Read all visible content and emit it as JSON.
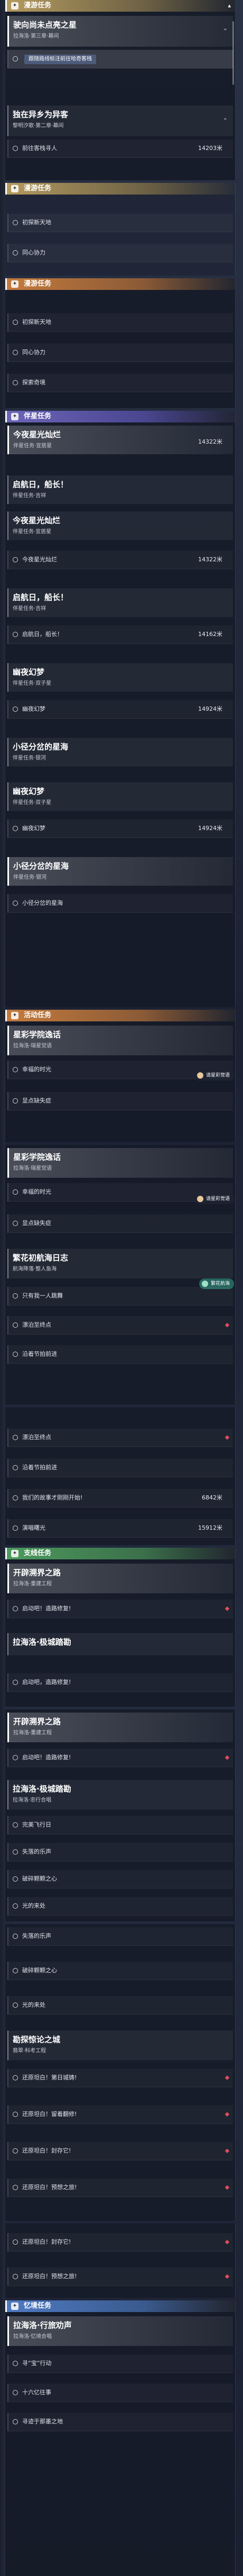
{
  "sections": {
    "trailblaze": "开拓任务",
    "companion": "同行任务",
    "adventure": "冒险任务",
    "daily": "日常任务",
    "event": "活动任务",
    "side": "支线任务",
    "memoir": "忆境任务"
  },
  "frame1": {
    "header": "漫游任务",
    "card1": {
      "title": "驶向尚未点亮之星",
      "sub": "拉海洛·第三章·幕间"
    },
    "step1": "跟随路线标注前往哈奇客栈",
    "card2": {
      "title": "独在异乡为异客",
      "sub": "黎明汐歌·第二章·幕间"
    },
    "step2": "前往客栈寻人",
    "dist2": "14203米"
  },
  "frame2": {
    "header": "漫游任务",
    "step1": "初探新天地",
    "step2": "同心协力"
  },
  "frame3": {
    "header": "漫游任务",
    "step1": "初探新天地",
    "step2": "同心协力",
    "step3": "探索奇境"
  },
  "frame4": {
    "header": "伴星任务",
    "card1": {
      "title": "今夜星光灿烂",
      "sub": "伴星任务·宜居星"
    },
    "dist1": "14322米",
    "card2": {
      "title": "启航日，船长！",
      "sub": "伴星任务·吉祥"
    },
    "card3": {
      "title": "今夜星光灿烂",
      "sub": "伴星任务·宜居星"
    },
    "step3": "今夜星光灿烂",
    "dist3": "14322米",
    "card4": {
      "title": "启航日，船长！",
      "sub": "伴星任务·吉祥"
    },
    "step4": "启航日，船长！",
    "dist4": "14162米",
    "card5": {
      "title": "幽夜幻梦",
      "sub": "伴星任务·双子星"
    },
    "step5": "幽夜幻梦",
    "dist5": "14924米",
    "card6": {
      "title": "小径分岔的星海",
      "sub": "伴星任务·银河"
    },
    "card7": {
      "title": "幽夜幻梦",
      "sub": "伴星任务·双子星"
    },
    "step7": "幽夜幻梦",
    "dist7": "14924米",
    "card8": {
      "title": "小径分岔的星海",
      "sub": "伴星任务·银河"
    },
    "step8": "小径分岔的星海"
  },
  "frame5": {
    "header": "活动任务",
    "card1": {
      "title": "星彩学院逸话",
      "sub": "拉海洛·瑞星觉语"
    },
    "step1": "幸福的时光",
    "hint": "请星彩觉语",
    "step2": "显点缺失症"
  },
  "frame6": {
    "card1": {
      "title": "星彩学院逸话",
      "sub": "拉海洛·瑞星觉语"
    },
    "step1": "幸福的时光",
    "hint": "请星彩觉语",
    "step2": "显点缺失症",
    "card2": {
      "title": "繁花初航海日志",
      "sub": "航海降落·整人鱼海"
    },
    "hint2": "繁花航海",
    "step3": "只有我一人跳舞",
    "step4": "漂泊至终点",
    "step5": "沿着节拍前进"
  },
  "frame7": {
    "step1": "漂泊至终点",
    "step2": "沿着节拍前进",
    "step3": "我们的故事才刚刚开始!",
    "dist3": "6842米",
    "step4": "演唱曙光",
    "dist4": "15912米"
  },
  "frame8": {
    "header": "支线任务",
    "card1": {
      "title": "开辟溯界之路",
      "sub": "拉海洛·重建工程"
    },
    "step1": "启动吧！造路修复!",
    "card2": {
      "title": "拉海洛·极城踏勘",
      "sub": ""
    },
    "step2": "启动吧，造路修复!"
  },
  "frame9": {
    "card1": {
      "title": "开辟溯界之路",
      "sub": "拉海洛·重建工程"
    },
    "step1": "启动吧！造路修复!",
    "card2": {
      "title": "拉海洛·极城踏勘",
      "sub": "拉海洛·忠行合唱"
    },
    "step2": "完美飞行日",
    "step3": "失落的乐声",
    "step4": "破碎颗颗之心",
    "step5": "光的来处"
  },
  "frame10": {
    "step1": "失落的乐声",
    "step2": "破碎颗颗之心",
    "step3": "光的来处",
    "card1": {
      "title": "勘探惊论之城",
      "sub": "翡翠·科考工程"
    },
    "step4": "还原坦白！第日城铸!",
    "step5": "还原坦白！留着翻修!",
    "step6": "还原坦白！封存它!",
    "step7": "还原坦白！预想之旅!"
  },
  "frame11": {
    "step1": "还原坦白！封存它!",
    "step2": "还原坦白！预想之旅!"
  },
  "frame12": {
    "header": "忆境任务",
    "card1": {
      "title": "拉海洛·行旅劝声",
      "sub": "拉海洛·忆境合唱"
    },
    "step1": "寻“宝”行动",
    "step2": "十六亿往事",
    "step3": "寻迹于那墨之地"
  },
  "colors": {
    "gold": "#b49a5e",
    "purple": "#6b64b8",
    "orange": "#c47b3d",
    "green": "#4d9a5e",
    "blue": "#4f7ac2",
    "marker": "#e24d58"
  }
}
